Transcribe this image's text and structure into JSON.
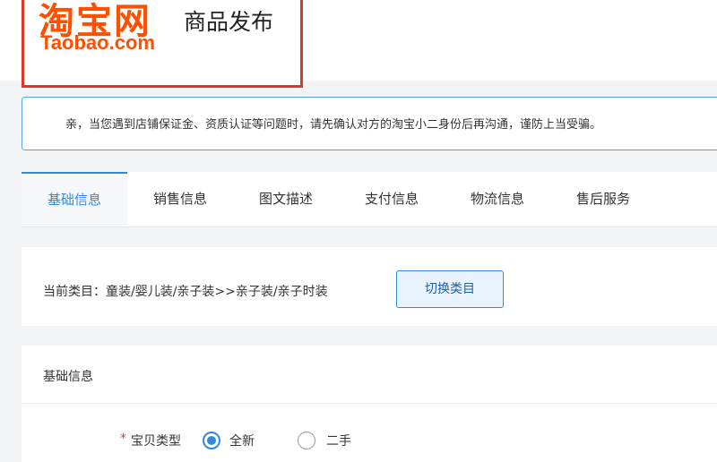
{
  "header": {
    "logo_cn": "淘宝网",
    "logo_en": "Taobao.com",
    "page_title": "商品发布"
  },
  "notice": {
    "text": "亲，当您遇到店铺保证金、资质认证等问题时，请先确认对方的淘宝小二身份后再沟通，谨防上当受骗。"
  },
  "tabs": [
    {
      "label": "基础信息",
      "active": true
    },
    {
      "label": "销售信息",
      "active": false
    },
    {
      "label": "图文描述",
      "active": false
    },
    {
      "label": "支付信息",
      "active": false
    },
    {
      "label": "物流信息",
      "active": false
    },
    {
      "label": "售后服务",
      "active": false
    }
  ],
  "category": {
    "text": "当前类目：童装/婴儿装/亲子装>>亲子装/亲子时装",
    "switch_label": "切换类目"
  },
  "basic_info": {
    "section_title": "基础信息",
    "item_type": {
      "required_mark": "*",
      "label": "宝贝类型",
      "options": [
        {
          "label": "全新",
          "selected": true
        },
        {
          "label": "二手",
          "selected": false
        }
      ]
    }
  },
  "colors": {
    "brand_orange": "#ff5000",
    "accent_blue": "#3089dc",
    "required_red": "#e4393c"
  }
}
